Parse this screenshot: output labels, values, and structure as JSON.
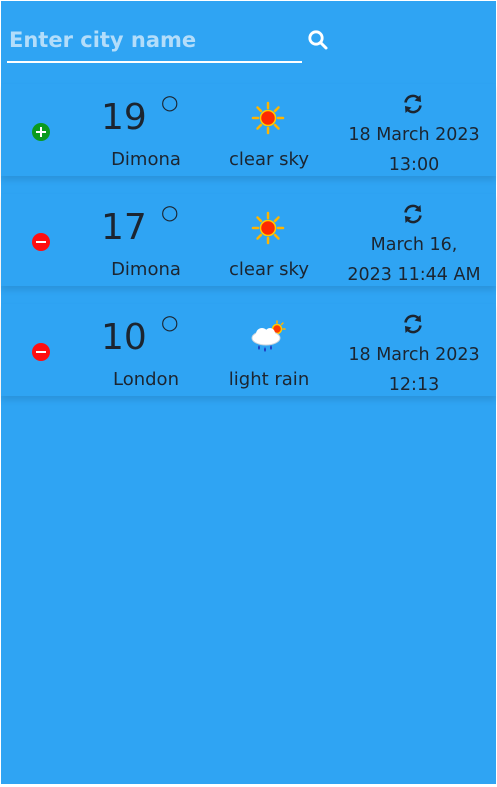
{
  "search": {
    "placeholder": "Enter city name",
    "value": ""
  },
  "colors": {
    "background": "#2fa4f3",
    "add": "#0b9a1e",
    "remove": "#ff0e10",
    "text": "#1c2530"
  },
  "cards": [
    {
      "action": "add",
      "action_icon": "plus-circle-icon",
      "temp": "19",
      "degree": "°",
      "city": "Dimona",
      "weather_icon": "sunny-icon",
      "description": "clear sky",
      "refresh_icon": "refresh-icon",
      "date_line1": "18 March 2023",
      "date_line2": "13:00"
    },
    {
      "action": "remove",
      "action_icon": "minus-circle-icon",
      "temp": "17",
      "degree": "°",
      "city": "Dimona",
      "weather_icon": "sunny-icon",
      "description": "clear sky",
      "refresh_icon": "refresh-icon",
      "date_line1": "March 16,",
      "date_line2": "2023 11:44 AM"
    },
    {
      "action": "remove",
      "action_icon": "minus-circle-icon",
      "temp": "10",
      "degree": "°",
      "city": "London",
      "weather_icon": "rain-cloud-icon",
      "description": "light rain",
      "refresh_icon": "refresh-icon",
      "date_line1": "18 March 2023",
      "date_line2": "12:13"
    }
  ]
}
